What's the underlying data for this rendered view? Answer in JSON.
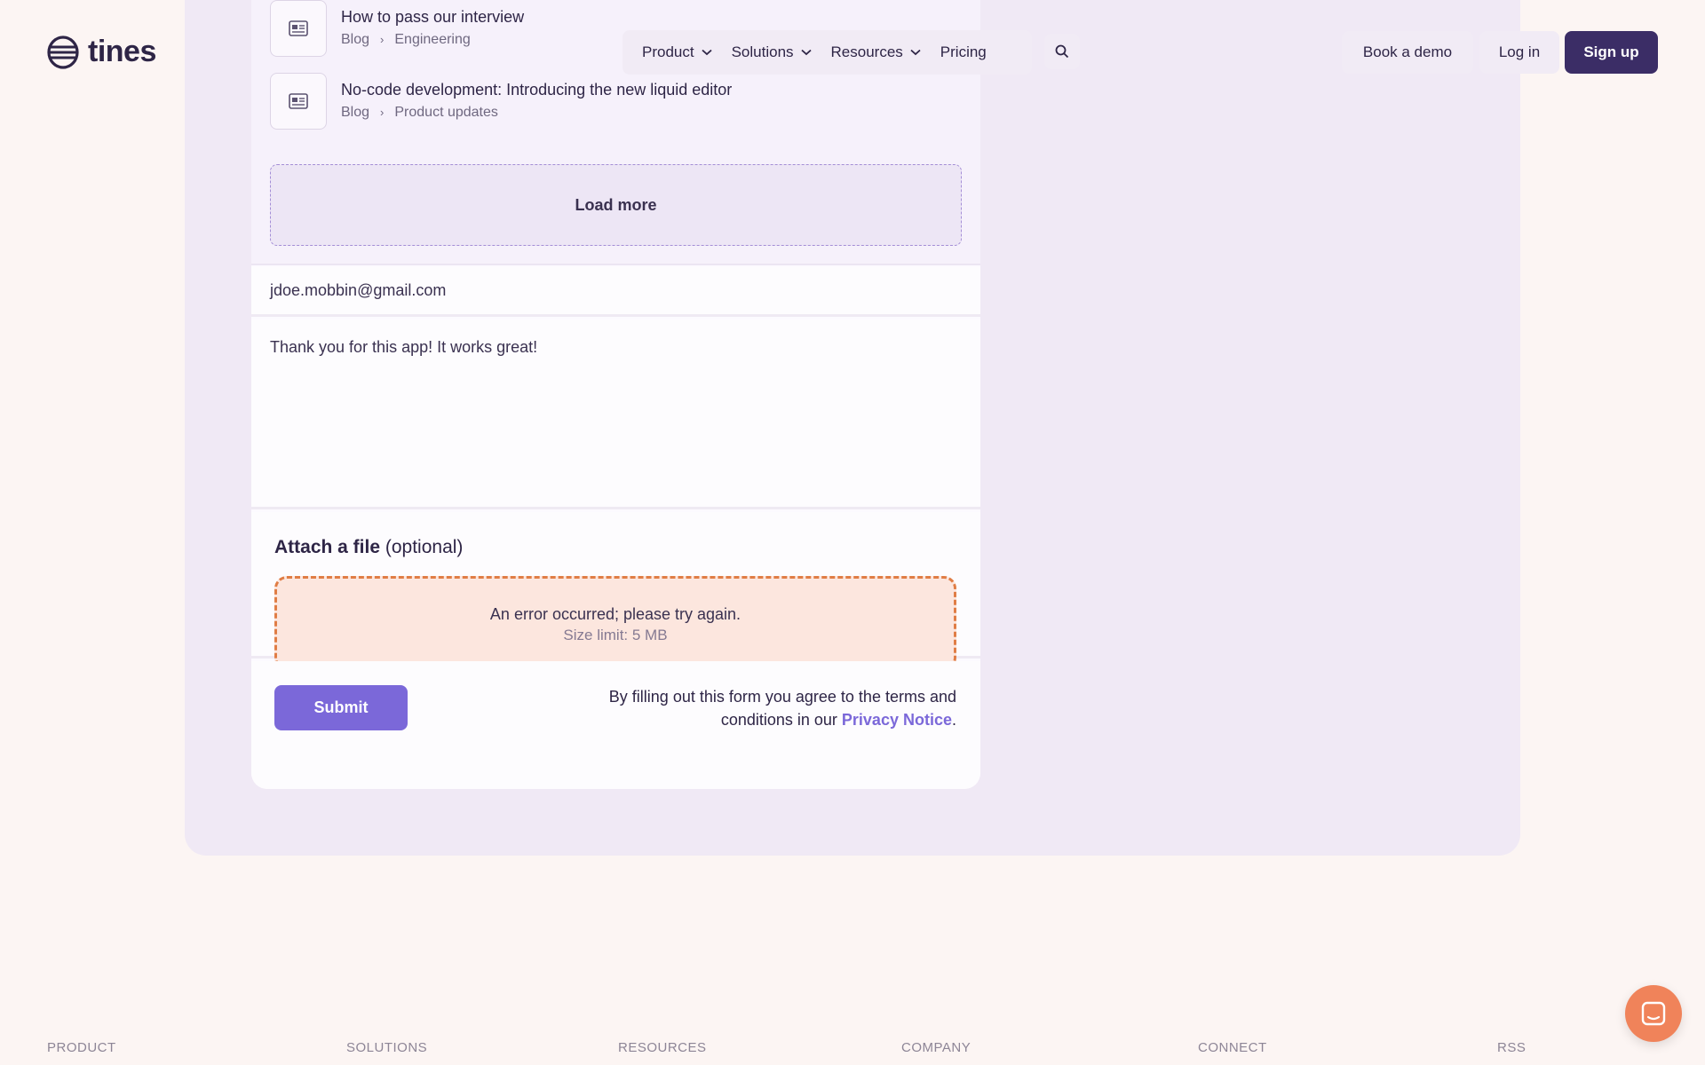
{
  "brand": {
    "name": "tines"
  },
  "nav": {
    "items": [
      {
        "label": "Product",
        "has_dropdown": true
      },
      {
        "label": "Solutions",
        "has_dropdown": true
      },
      {
        "label": "Resources",
        "has_dropdown": true
      },
      {
        "label": "Pricing",
        "has_dropdown": false
      }
    ],
    "search_icon": "search-icon",
    "book_demo": "Book a demo",
    "login": "Log in",
    "signup": "Sign up"
  },
  "results": [
    {
      "title": "How to pass our interview",
      "crumb_1": "Blog",
      "sep": "›",
      "crumb_2": "Engineering",
      "icon": "article-icon"
    },
    {
      "title": "No-code development: Introducing the new liquid editor",
      "crumb_1": "Blog",
      "sep": "›",
      "crumb_2": "Product updates",
      "icon": "article-icon"
    }
  ],
  "load_more": "Load more",
  "form": {
    "email_value": "jdoe.mobbin@gmail.com",
    "message_value": "Thank you for this app! It works great!",
    "attach_label": "Attach a file",
    "attach_optional": " (optional)",
    "error_text": "An error occurred; please try again.",
    "size_limit": "Size limit: 5 MB",
    "submit": "Submit",
    "terms_prefix": "By filling out this form you agree to the terms and conditions in our ",
    "privacy_link": "Privacy Notice",
    "terms_suffix": "."
  },
  "footer": {
    "columns": [
      "PRODUCT",
      "SOLUTIONS",
      "RESOURCES",
      "COMPANY",
      "CONNECT",
      "RSS"
    ]
  },
  "colors": {
    "accent": "#7b68d9",
    "brand_dark": "#3b2d66",
    "error_border": "#e07d45",
    "error_bg": "#fce6de",
    "chat": "#f0835a"
  }
}
